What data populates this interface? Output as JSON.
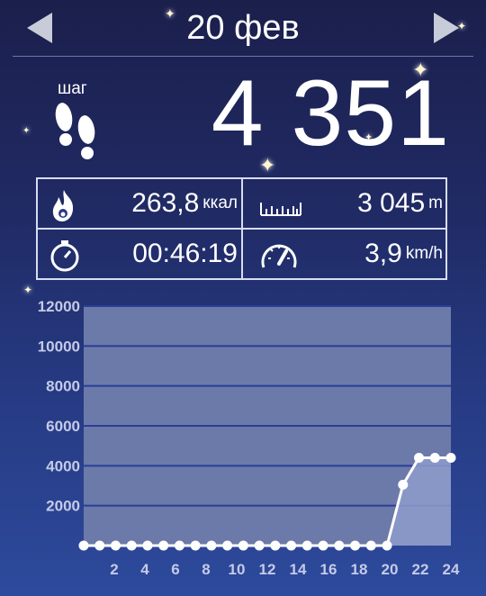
{
  "header": {
    "date": "20 фев",
    "prev": "previous-day",
    "next": "next-day"
  },
  "steps": {
    "label": "шаг",
    "value": "4 351"
  },
  "stats": {
    "calories": {
      "value": "263,8",
      "unit": "ккал",
      "icon": "flame-icon"
    },
    "distance": {
      "value": "3 045",
      "unit": "m",
      "icon": "ruler-icon"
    },
    "duration": {
      "value": "00:46:19",
      "icon": "stopwatch-icon"
    },
    "speed": {
      "value": "3,9",
      "unit": "km/h",
      "icon": "speedometer-icon"
    }
  },
  "chart_data": {
    "type": "area",
    "title": "",
    "xlabel": "",
    "ylabel": "",
    "ylim": [
      0,
      12000
    ],
    "yticks": [
      2000,
      4000,
      6000,
      8000,
      10000,
      12000
    ],
    "xtick_labels": [
      "2",
      "4",
      "6",
      "8",
      "10",
      "12",
      "14",
      "16",
      "18",
      "20",
      "22",
      "24"
    ],
    "x": [
      1,
      2,
      3,
      4,
      5,
      6,
      7,
      8,
      9,
      10,
      11,
      12,
      13,
      14,
      15,
      16,
      17,
      18,
      19,
      20,
      21,
      22,
      23,
      24
    ],
    "values": [
      0,
      0,
      0,
      0,
      0,
      0,
      0,
      0,
      0,
      0,
      0,
      0,
      0,
      0,
      0,
      0,
      0,
      0,
      0,
      0,
      3050,
      4400,
      4400,
      4400
    ],
    "grid": true,
    "colors": {
      "line": "#ffffff",
      "fill": "#8e9ccd",
      "plot_bg": "#6c7aaa",
      "grid": "#2a3e96"
    }
  }
}
